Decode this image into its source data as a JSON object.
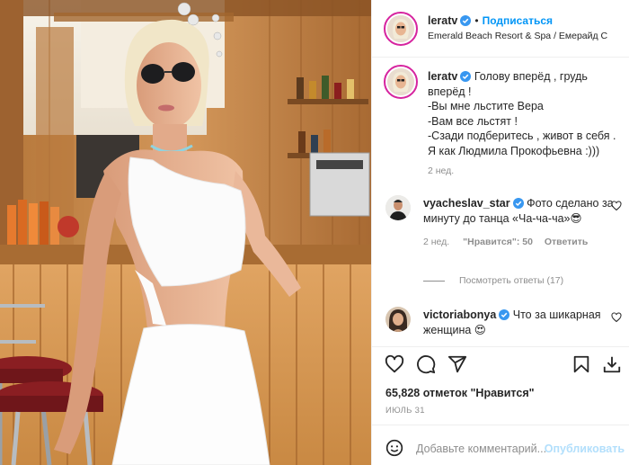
{
  "post": {
    "author": "leratv",
    "follow_label": "Подписаться",
    "dot": "•",
    "location": "Emerald Beach Resort & Spa / Емерайд С",
    "caption_lines": [
      "Голову вперёд , грудь",
      "вперёд !",
      "-Вы мне льстите Вера",
      "-Вам все льстят !",
      "-Сзади подберитесь , живот в себя .",
      "Я как Людмила Прокофьевна :)))"
    ],
    "caption_time": "2 нед."
  },
  "comments": [
    {
      "user": "vyacheslav_star",
      "text_lines": [
        "Фото сделано за",
        "минуту до танца «Ча-ча-ча»😎"
      ],
      "time": "2 нед.",
      "likes": "\"Нравится\": 50",
      "reply": "Ответить",
      "view_replies": "Посмотреть ответы (17)"
    },
    {
      "user": "victoriabonya",
      "text_lines": [
        "Что за шикарная",
        "женщина 😍"
      ]
    }
  ],
  "actions": {
    "likes_text": "65,828 отметок \"Нравится\"",
    "date": "ИЮЛЬ 31"
  },
  "add_comment": {
    "placeholder": "Добавьте комментарий...",
    "publish": "Опубликовать"
  },
  "colors": {
    "accent": "#0095f6",
    "verified": "#3897f0",
    "muted": "#8e8e8e",
    "publish_disabled": "#b2dffc"
  },
  "icons": [
    "verified-badge-icon",
    "heart-icon",
    "comment-icon",
    "share-icon",
    "bookmark-icon",
    "download-icon",
    "emoji-icon"
  ]
}
